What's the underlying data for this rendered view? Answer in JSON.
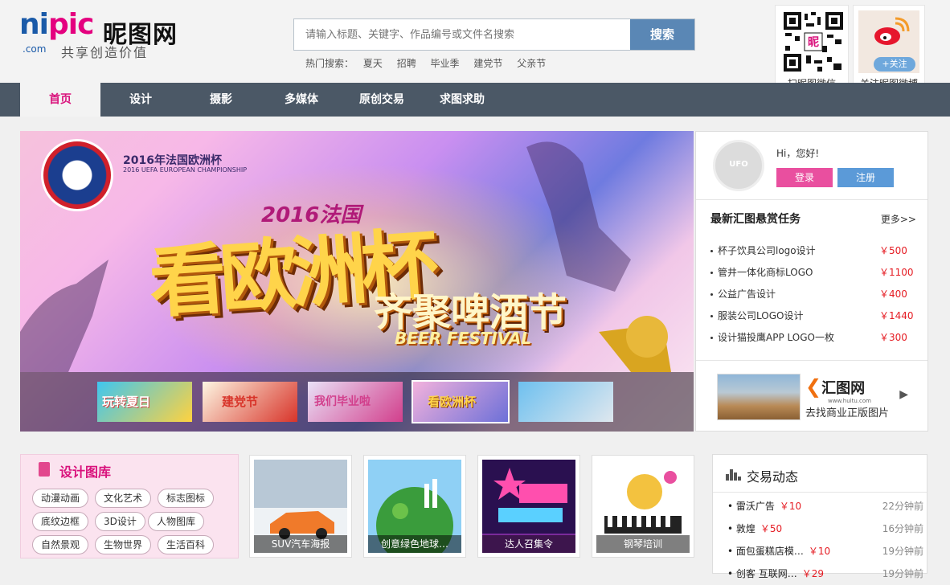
{
  "logo": {
    "brand_en_a": "ni",
    "brand_en_b": "pic",
    "brand_cn": "昵图网",
    "com": ".com",
    "slogan": "共享创造价值"
  },
  "search": {
    "placeholder": "请输入标题、关键字、作品编号或文件名搜索",
    "button": "搜索"
  },
  "hot": {
    "label": "热门搜索：",
    "items": [
      "夏天",
      "招聘",
      "毕业季",
      "建党节",
      "父亲节"
    ]
  },
  "qr": {
    "label": "扫昵图微信",
    "badge": "昵"
  },
  "weibo": {
    "label": "关注昵图微博",
    "follow": "+关注"
  },
  "nav": {
    "items": [
      "首页",
      "设计",
      "摄影",
      "多媒体",
      "原创交易",
      "求图求助"
    ],
    "active": 0
  },
  "banner": {
    "sub1": "2016年法国欧洲杯",
    "sub2": "2016 UEFA EUROPEAN CHAMPIONSHIP",
    "year_title": "2016法国",
    "title": "看欧洲杯",
    "title2": "齐聚啤酒节",
    "en": "BEER FESTIVAL",
    "thumbs": [
      {
        "text": "玩转夏日",
        "colors": [
          "#3ec6f0",
          "#ffd23f"
        ]
      },
      {
        "text": "建党节",
        "colors": [
          "#fdf6e2",
          "#d8342a"
        ]
      },
      {
        "text": "我们毕业啦",
        "colors": [
          "#e9e0f7",
          "#d23f8c"
        ]
      },
      {
        "text": "看欧洲杯",
        "colors": [
          "#f3b2dc",
          "#6d70d8"
        ]
      },
      {
        "text": "",
        "colors": [
          "#6ec0ef",
          "#dfe7ee"
        ]
      }
    ],
    "active_thumb": 3
  },
  "user": {
    "avatar_text": "UFO",
    "greeting": "Hi，您好!",
    "login": "登录",
    "register": "注册"
  },
  "tasks": {
    "title": "最新汇图悬赏任务",
    "more": "更多>>",
    "items": [
      {
        "name": "杯子饮具公司logo设计",
        "price": "￥500"
      },
      {
        "name": "管井一体化商标LOGO",
        "price": "￥1100"
      },
      {
        "name": "公益广告设计",
        "price": "￥400"
      },
      {
        "name": "服装公司LOGO设计",
        "price": "￥1440"
      },
      {
        "name": "设计猫投鹰APP LOGO一枚",
        "price": "￥300"
      }
    ]
  },
  "huitu": {
    "logo": "汇图网",
    "logo_sub": "www.huitu.com",
    "text": "去找商业正版图片",
    "arrow": "▶"
  },
  "library": {
    "title": "设计图库",
    "tags": [
      "动漫动画",
      "文化艺术",
      "标志图标",
      "底纹边框",
      "3D设计",
      "人物图库",
      "自然景观",
      "生物世界",
      "生活百科"
    ]
  },
  "gallery": [
    {
      "caption": "SUV汽车海报",
      "colors": [
        "#c9d6e2",
        "#ff7b2a"
      ]
    },
    {
      "caption": "创意绿色地球…",
      "colors": [
        "#7cc3f0",
        "#2f9a3a"
      ]
    },
    {
      "caption": "达人召集令",
      "colors": [
        "#3a1a6a",
        "#ff4fae"
      ]
    },
    {
      "caption": "钢琴培训",
      "colors": [
        "#ffffff",
        "#f3c23f"
      ]
    }
  ],
  "trade": {
    "title": "交易动态",
    "items": [
      {
        "name": "雷沃广告",
        "price": "￥10",
        "time": "22分钟前"
      },
      {
        "name": "敦煌",
        "price": "￥50",
        "time": "16分钟前"
      },
      {
        "name": "面包蛋糕店模…",
        "price": "￥10",
        "time": "19分钟前"
      },
      {
        "name": "创客 互联网…",
        "price": "￥29",
        "time": "19分钟前"
      }
    ]
  }
}
